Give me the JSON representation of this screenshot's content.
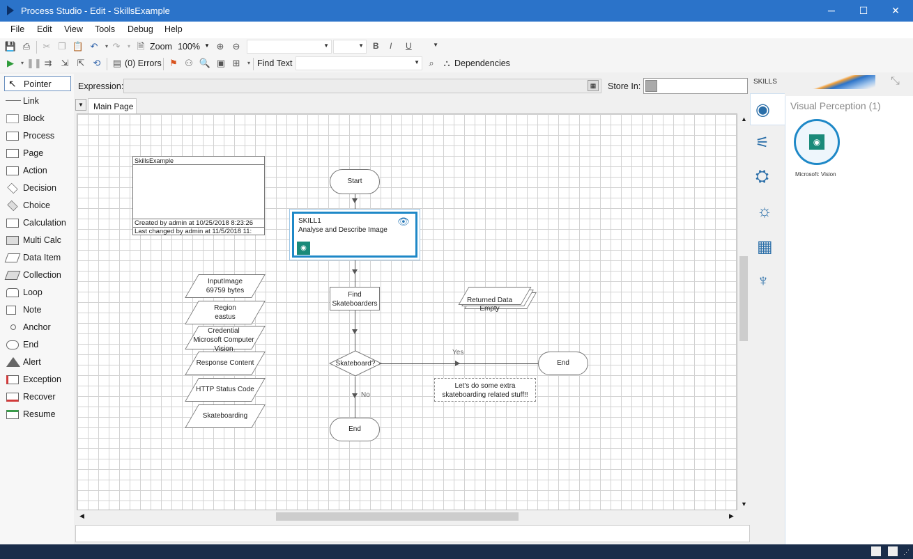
{
  "window": {
    "title": "Process Studio  -  Edit - SkillsExample",
    "controls": [
      "─",
      "☐",
      "✕"
    ]
  },
  "menu": [
    "File",
    "Edit",
    "View",
    "Tools",
    "Debug",
    "Help"
  ],
  "toolbar1": {
    "zoom_label": "Zoom",
    "zoom_value": "100%",
    "bold": "B",
    "italic": "I",
    "underline": "U"
  },
  "toolbar2": {
    "errors_label": "(0) Errors",
    "find_label": "Find Text",
    "dependencies_label": "Dependencies"
  },
  "palette": [
    "Pointer",
    "Link",
    "Block",
    "Process",
    "Page",
    "Action",
    "Decision",
    "Choice",
    "Calculation",
    "Multi Calc",
    "Data Item",
    "Collection",
    "Loop",
    "Note",
    "Anchor",
    "End",
    "Alert",
    "Exception",
    "Recover",
    "Resume"
  ],
  "expression": {
    "label": "Expression:",
    "store_label": "Store In:"
  },
  "tabs": {
    "main_page": "Main Page"
  },
  "diagram": {
    "info_title": "SkillsExample",
    "info_created": "Created by admin at 10/25/2018 8:23:26",
    "info_changed": "Last changed by admin at 11/5/2018 11:",
    "start": "Start",
    "skill_name": "SKILL1",
    "skill_desc": "Analyse and Describe Image",
    "find": "Find Skateboarders",
    "decision": "Skateboard?",
    "yes": "Yes",
    "no": "No",
    "end_right": "End",
    "end_bottom": "End",
    "note": "Let's do some extra skateboarding related stuff!!",
    "returned_data": "Returned Data\nEmpty",
    "data_items": [
      "InputImage\n69759 bytes",
      "Region\neastus",
      "Credential\nMicrosoft Computer\nVision",
      "Response Content",
      "HTTP Status Code",
      "Skateboarding"
    ]
  },
  "skills_panel": {
    "header": "SKILLS",
    "category": "Visual Perception (1)",
    "skill_label": "Microsoft: Vision"
  },
  "colors": {
    "titlebar": "#2b73c9",
    "accent": "#1e88c7",
    "skill_teal": "#1a8a7a",
    "statusbar": "#1a2d4a"
  }
}
